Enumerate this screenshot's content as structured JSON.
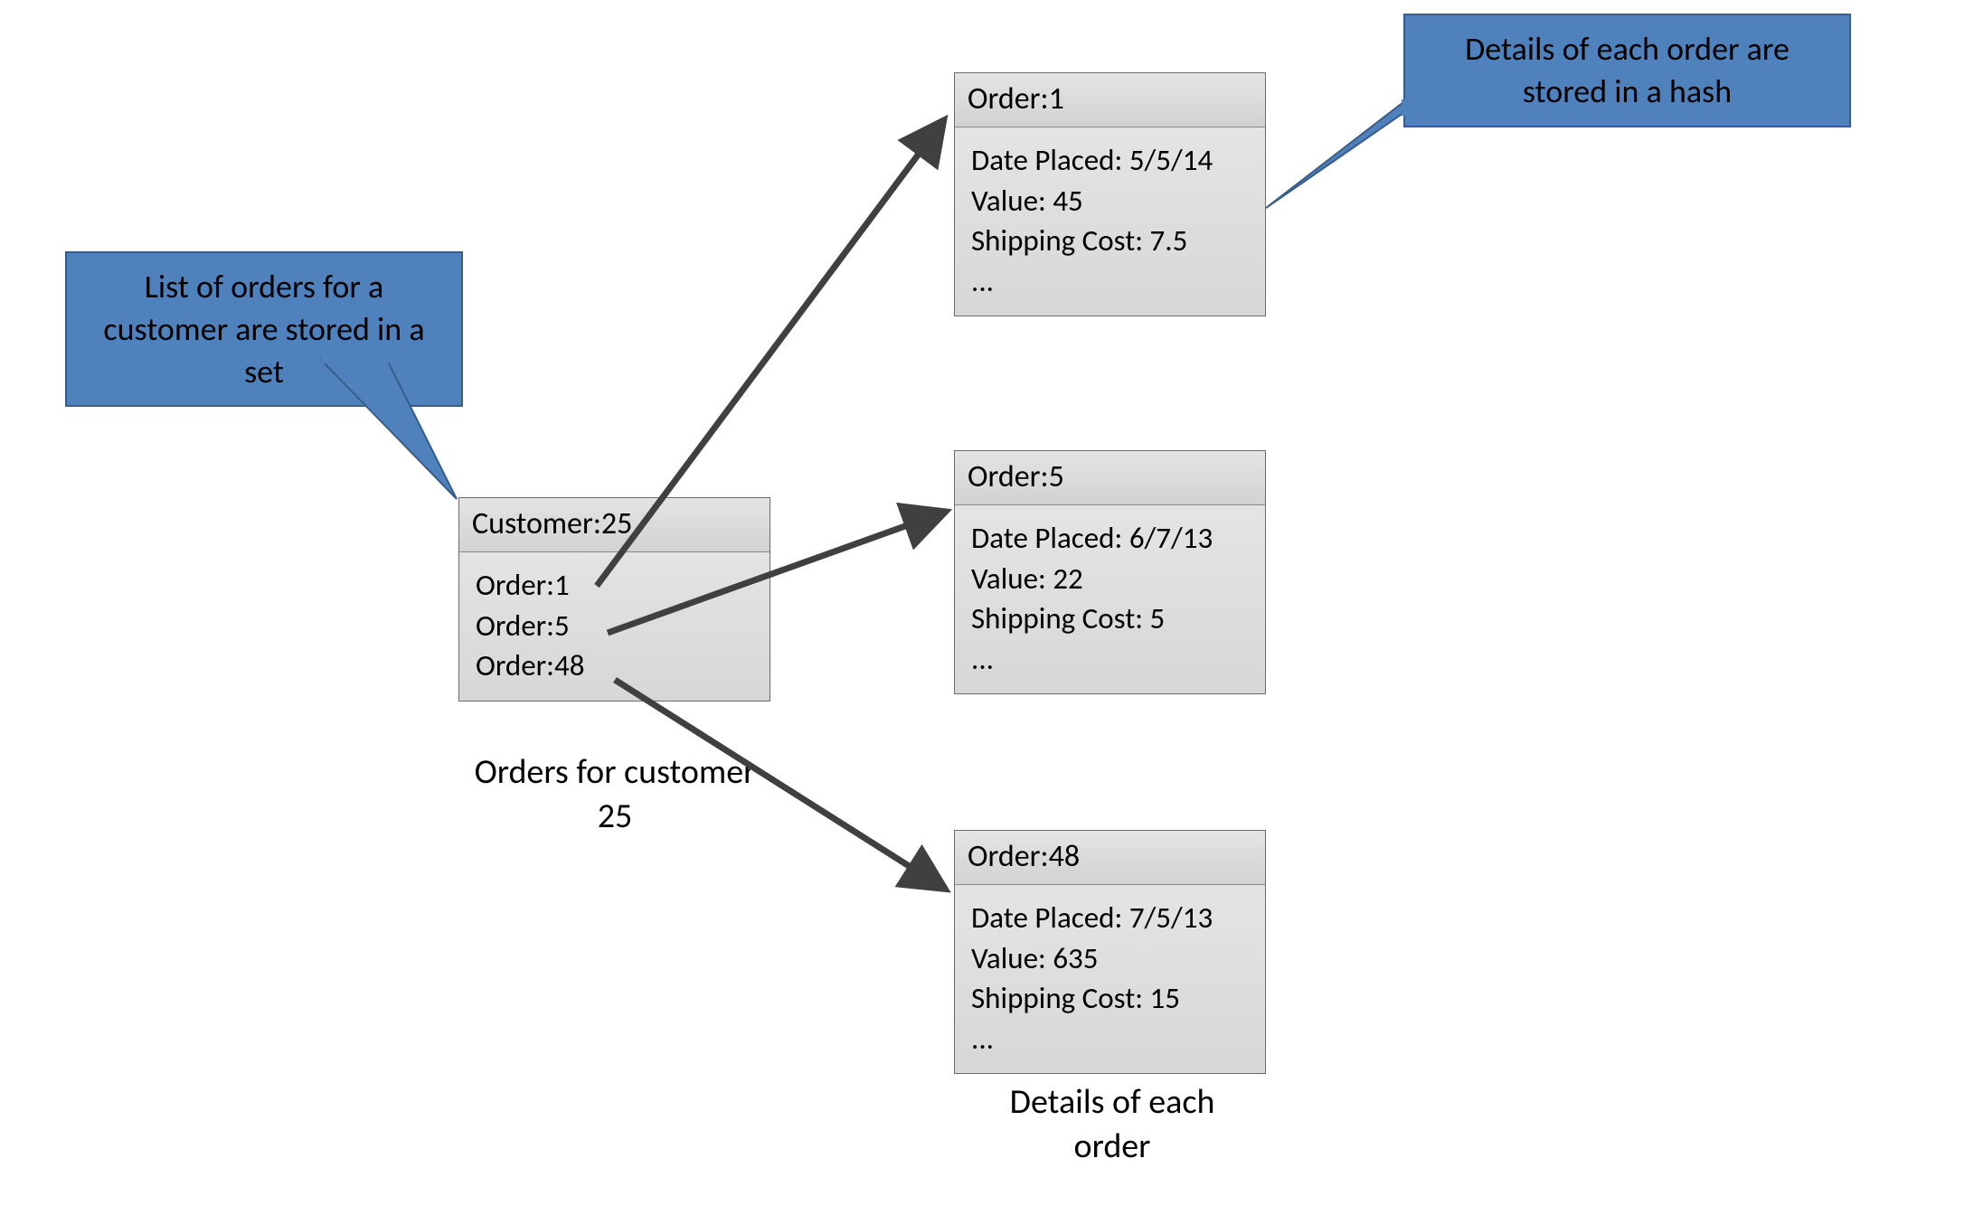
{
  "callouts": {
    "set": "List of orders for a customer are stored in a set",
    "hash": "Details of each order are stored in a hash"
  },
  "customerBox": {
    "header": "Customer:25",
    "lines": [
      "Order:1",
      "Order:5",
      "Order:48"
    ]
  },
  "orderBoxes": [
    {
      "header": "Order:1",
      "lines": [
        "Date Placed: 5/5/14",
        "Value: 45",
        "Shipping Cost: 7.5",
        "..."
      ]
    },
    {
      "header": "Order:5",
      "lines": [
        "Date Placed: 6/7/13",
        "Value: 22",
        "Shipping Cost: 5",
        "..."
      ]
    },
    {
      "header": "Order:48",
      "lines": [
        "Date Placed: 7/5/13",
        "Value: 635",
        "Shipping Cost: 15",
        "..."
      ]
    }
  ],
  "captions": {
    "customer": "Orders for customer 25",
    "orders": "Details of each order"
  }
}
